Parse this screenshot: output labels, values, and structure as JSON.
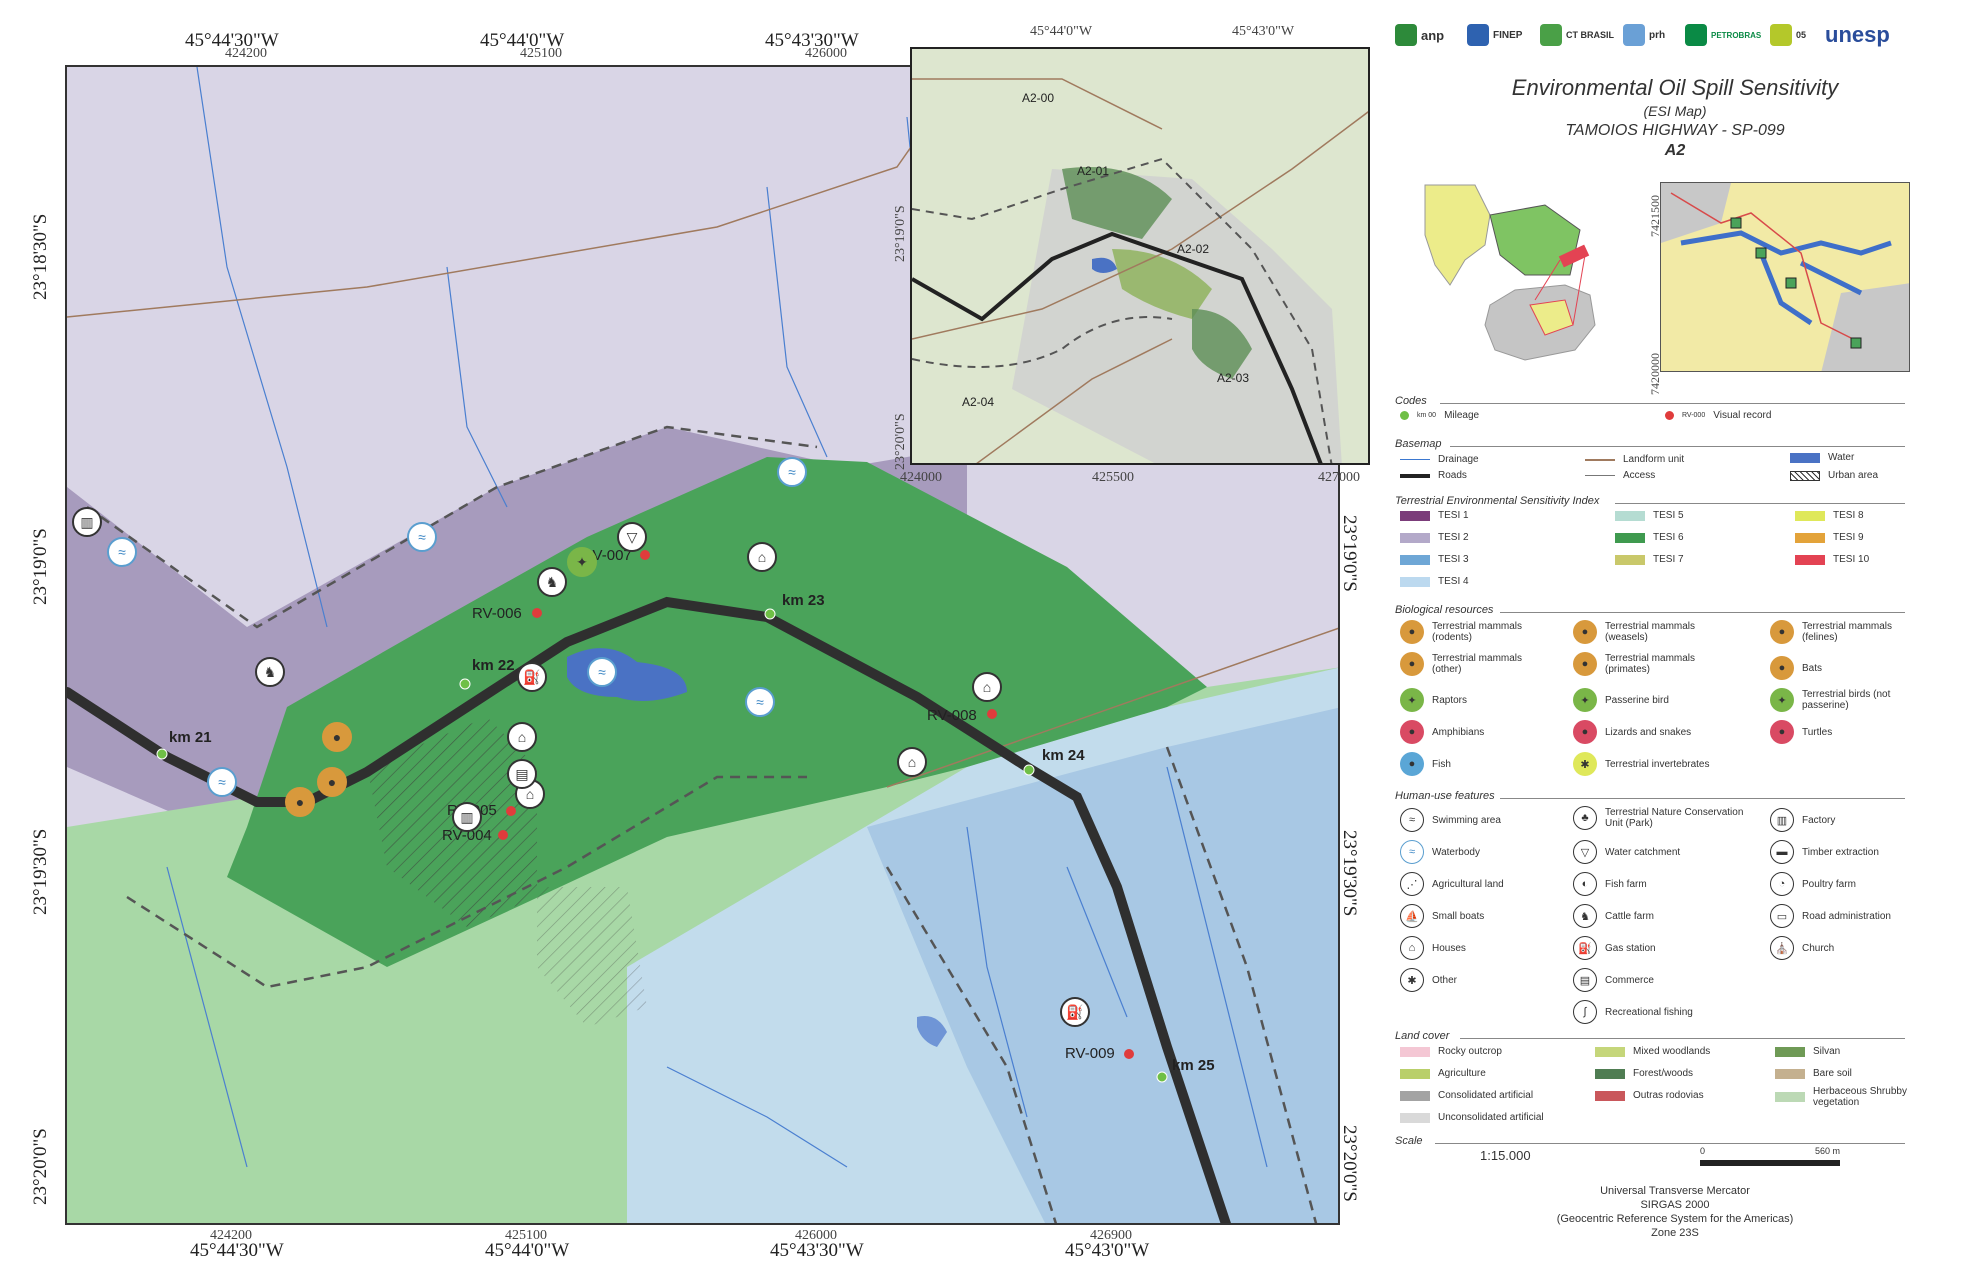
{
  "coords": {
    "top_geo": [
      "45°44'30\"W",
      "45°44'0\"W",
      "45°43'30\"W"
    ],
    "top_utm": [
      "424200",
      "425100",
      "426000"
    ],
    "bottom_geo": [
      "45°44'30\"W",
      "45°44'0\"W",
      "45°43'30\"W",
      "45°43'0\"W"
    ],
    "bottom_utm": [
      "424200",
      "425100",
      "426000",
      "426900"
    ],
    "left_geo": [
      "23°18'30\"S",
      "23°19'0\"S",
      "23°19'30\"S",
      "23°20'0\"S"
    ],
    "right_geo": [
      "23°19'0\"S",
      "23°19'30\"S",
      "23°20'0\"S"
    ]
  },
  "main_map": {
    "km_labels": [
      "km 21",
      "km 22",
      "km 23",
      "km 24",
      "km 25"
    ],
    "rv_labels": [
      "RV-004",
      "RV-005",
      "RV-006",
      "RV-007",
      "RV-008",
      "RV-009"
    ]
  },
  "inset": {
    "top_geo": [
      "45°44'0\"W",
      "45°43'0\"W"
    ],
    "bottom_utm": [
      "424000",
      "425500",
      "427000"
    ],
    "left_geo": [
      "23°19'0\"S",
      "23°20'0\"S"
    ],
    "right_utm": [
      "7421500",
      "7420000"
    ],
    "sheets": [
      "A2-00",
      "A2-01",
      "A2-02",
      "A2-03",
      "A2-04"
    ]
  },
  "logos": [
    "anp",
    "FINEP",
    "CT BRASIL",
    "prh",
    "PETROBRAS",
    "05",
    "unesp"
  ],
  "title": {
    "line1": "Environmental Oil Spill Sensitivity",
    "line2": "(ESI Map)",
    "line3": "TAMOIOS HIGHWAY - SP-099",
    "line4": "A2"
  },
  "codes": {
    "heading": "Codes",
    "mileage_code": "km 00",
    "mileage": "Mileage",
    "visual_code": "RV-000",
    "visual": "Visual record"
  },
  "basemap": {
    "heading": "Basemap",
    "items": [
      "Drainage",
      "Roads",
      "Landform unit",
      "Access",
      "Water",
      "Urban area"
    ]
  },
  "tesi": {
    "heading": "Terrestrial Environmental Sensitivity Index",
    "items": [
      {
        "label": "TESI 1",
        "color": "#7b3c7a"
      },
      {
        "label": "TESI 2",
        "color": "#b3a9c9"
      },
      {
        "label": "TESI 3",
        "color": "#6fa7d6"
      },
      {
        "label": "TESI 4",
        "color": "#bcd9ef"
      },
      {
        "label": "TESI 5",
        "color": "#b5dcd2"
      },
      {
        "label": "TESI 6",
        "color": "#3f9a4f"
      },
      {
        "label": "TESI 7",
        "color": "#c9c86a"
      },
      {
        "label": "TESI 8",
        "color": "#dfe85a"
      },
      {
        "label": "TESI 9",
        "color": "#e3a33a"
      },
      {
        "label": "TESI 10",
        "color": "#e34353"
      }
    ]
  },
  "bio": {
    "heading": "Biological resources",
    "items": [
      "Terrestrial mammals (rodents)",
      "Terrestrial mammals (weasels)",
      "Terrestrial mammals (felines)",
      "Terrestrial mammals (other)",
      "Terrestrial mammals (primates)",
      "Bats",
      "Raptors",
      "Passerine bird",
      "Terrestrial birds (not passerine)",
      "Amphibians",
      "Lizards and snakes",
      "Turtles",
      "Fish",
      "Terrestrial invertebrates"
    ]
  },
  "human": {
    "heading": "Human-use features",
    "items": [
      "Swimming area",
      "Terrestrial Nature Conservation Unit (Park)",
      "Factory",
      "Waterbody",
      "Water catchment",
      "Timber extraction",
      "Agricultural land",
      "Fish farm",
      "Poultry farm",
      "Small boats",
      "Cattle farm",
      "Road administration",
      "Houses",
      "Gas station",
      "Church",
      "Other",
      "Commerce",
      "",
      "",
      "Recreational fishing",
      ""
    ]
  },
  "landcover": {
    "heading": "Land cover",
    "items": [
      {
        "label": "Rocky outcrop",
        "color": "#f4c7d4"
      },
      {
        "label": "Mixed woodlands",
        "color": "#c5d67a"
      },
      {
        "label": "Silvan",
        "color": "#6f9a56"
      },
      {
        "label": "Agriculture",
        "color": "#b9cf6a"
      },
      {
        "label": "Forest/woods",
        "color": "#4f7d52"
      },
      {
        "label": "Bare soil",
        "color": "#c4b08f"
      },
      {
        "label": "Consolidated artificial",
        "color": "#a3a3a3"
      },
      {
        "label": "Outras rodovias",
        "color": "#c9575b"
      },
      {
        "label": "Herbaceous Shrubby vegetation",
        "color": "#bcd9b5"
      },
      {
        "label": "Unconsolidated artificial",
        "color": "#d9d9d9"
      }
    ]
  },
  "scale": {
    "heading": "Scale",
    "ratio": "1:15.000",
    "zero": "0",
    "end": "560 m"
  },
  "projection": {
    "line1": "Universal Transverse Mercator",
    "line2": "SIRGAS 2000",
    "line3": "(Geocentric Reference System for the  Americas)",
    "line4": "Zone 23S"
  }
}
